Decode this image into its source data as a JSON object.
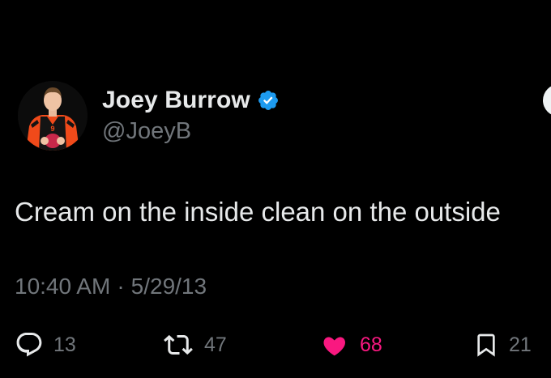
{
  "author": {
    "display_name": "Joey Burrow",
    "handle": "@JoeyB",
    "verified": true,
    "verified_color": "#1d9bf0"
  },
  "tweet": {
    "text": "Cream on the inside clean on the outside",
    "time": "10:40 AM",
    "separator": "·",
    "date": "5/29/13"
  },
  "actions": {
    "replies": "13",
    "retweets": "47",
    "likes": "68",
    "bookmarks": "21",
    "liked": true,
    "like_color": "#f91880"
  },
  "icons": {
    "reply": "speech-bubble-icon",
    "retweet": "retweet-arrows-icon",
    "like": "heart-filled-icon",
    "bookmark": "bookmark-icon",
    "verified": "verified-badge-icon"
  },
  "colors": {
    "background": "#000000",
    "text_primary": "#e7e9ea",
    "text_secondary": "#71767b"
  }
}
